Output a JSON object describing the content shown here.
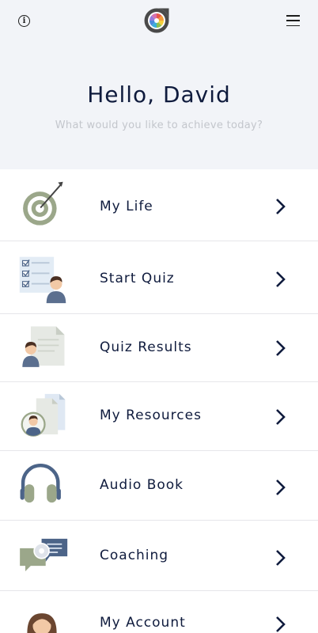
{
  "header": {
    "greeting": "Hello, David",
    "subtitle": "What would you like to achieve today?",
    "info_glyph": "i",
    "info_icon": "info-icon",
    "logo_icon": "color-wheel-logo-icon",
    "menu_icon": "hamburger-menu-icon"
  },
  "menu": {
    "items": [
      {
        "label": "My Life",
        "icon": "target-arrow-icon"
      },
      {
        "label": "Start Quiz",
        "icon": "quiz-checklist-icon"
      },
      {
        "label": "Quiz Results",
        "icon": "quiz-results-document-icon"
      },
      {
        "label": "My Resources",
        "icon": "resources-documents-icon"
      },
      {
        "label": "Audio Book",
        "icon": "headphones-icon"
      },
      {
        "label": "Coaching",
        "icon": "coaching-chat-icon"
      },
      {
        "label": "My Account",
        "icon": "account-avatar-icon"
      }
    ]
  },
  "colors": {
    "header_bg": "#f2f4f8",
    "text_primary": "#0f1b3d",
    "text_muted": "#c3c6cc",
    "icon_green": "#9ba78a",
    "icon_blue": "#4c6488",
    "divider": "#e6e6ea"
  }
}
